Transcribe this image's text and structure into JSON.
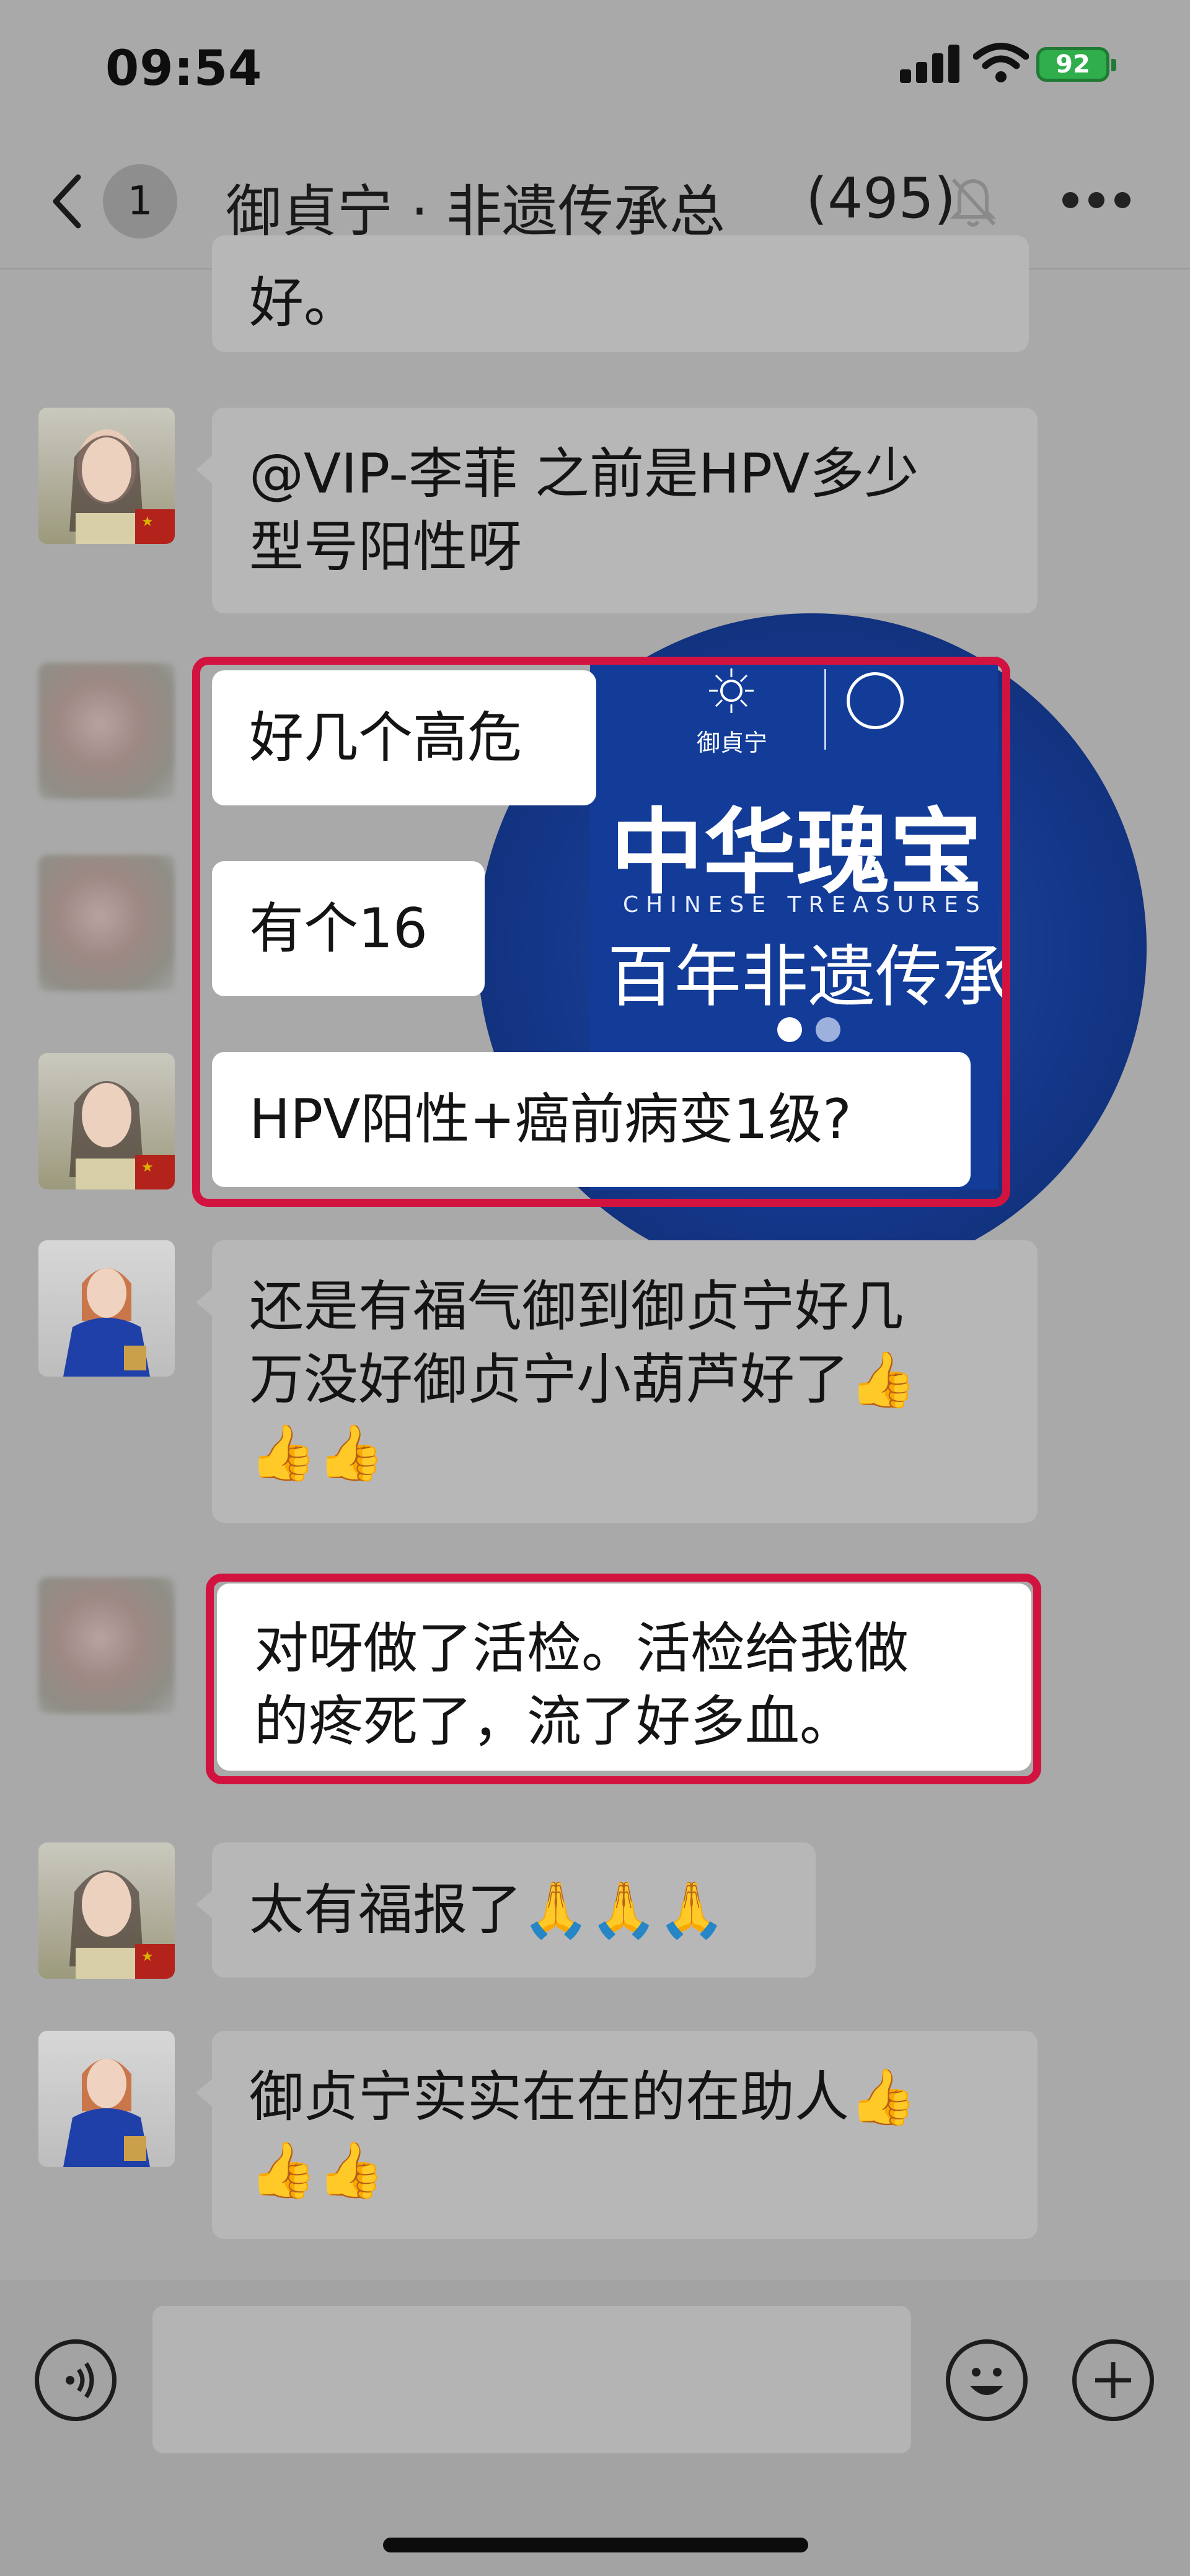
{
  "status": {
    "time": "09:54",
    "battery": "92"
  },
  "nav": {
    "unread": "1",
    "title": "御貞宁 · 非遗传承总",
    "member_count": "(495)"
  },
  "messages": [
    {
      "text": "好。"
    },
    {
      "line1": "@VIP-李菲 之前是HPV多少",
      "line2": "型号阳性呀"
    },
    {
      "text": "好几个高危"
    },
    {
      "text": "有个16"
    },
    {
      "text": "HPV阳性+癌前病变1级?"
    },
    {
      "line1": "还是有福气御到御贞宁好几",
      "line2": "万没好御贞宁小葫芦好了👍",
      "line3": "👍👍"
    },
    {
      "line1": "对呀做了活检。活检给我做",
      "line2": "的疼死了，流了好多血。"
    },
    {
      "text": "太有福报了🙏🙏🙏"
    },
    {
      "line1": "御贞宁实实在在的在助人👍",
      "line2": "👍👍"
    }
  ],
  "ad": {
    "brand": "御貞宁",
    "headline": "中华瑰宝",
    "english": "CHINESE TREASURES",
    "subline": "百年非遗传承"
  },
  "colors": {
    "highlight": "#d21340",
    "bubble_other": "#b7b7b7",
    "ad_blue": "#133c99"
  }
}
